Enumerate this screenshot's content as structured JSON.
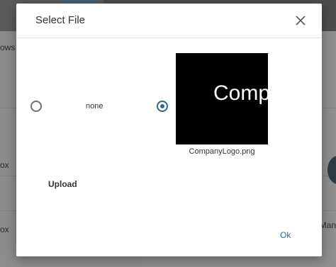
{
  "background": {
    "row_labels": [
      "ows",
      "ox",
      "ox"
    ],
    "right_label": "Man"
  },
  "dialog": {
    "title": "Select File",
    "close_icon": "close-icon",
    "options": [
      {
        "label": "none",
        "selected": false
      },
      {
        "label": "CompanyLogo.png",
        "selected": true,
        "thumbnail_text": "Compa"
      }
    ],
    "upload_label": "Upload",
    "ok_label": "Ok"
  },
  "colors": {
    "accent": "#2e6694",
    "overlay": "#8e8e8e"
  }
}
